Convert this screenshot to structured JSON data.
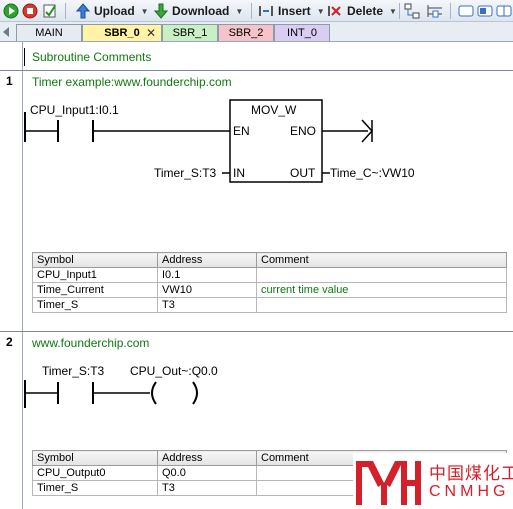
{
  "toolbar": {
    "upload_label": "Upload",
    "download_label": "Download",
    "insert_label": "Insert",
    "delete_label": "Delete"
  },
  "tabs": [
    {
      "label": "MAIN",
      "active": false,
      "color": "#e6ebf1"
    },
    {
      "label": "SBR_0",
      "active": true,
      "color": "#fff3a8"
    },
    {
      "label": "SBR_1",
      "active": false,
      "color": "#c9f0c4"
    },
    {
      "label": "SBR_2",
      "active": false,
      "color": "#f7c3c8"
    },
    {
      "label": "INT_0",
      "active": false,
      "color": "#d9cdf2"
    }
  ],
  "subroutine_comments": "Subroutine Comments",
  "networks": [
    {
      "number": "1",
      "title": "Timer example:www.founderchip.com",
      "contact_label": "CPU_Input1:I0.1",
      "block_name": "MOV_W",
      "pin_en": "EN",
      "pin_eno": "ENO",
      "pin_in": "IN",
      "pin_out": "OUT",
      "in_operand": "Timer_S:T3",
      "out_operand": "Time_C~:VW10",
      "symbol_table": {
        "headers": [
          "Symbol",
          "Address",
          "Comment"
        ],
        "rows": [
          [
            "CPU_Input1",
            "I0.1",
            ""
          ],
          [
            "Time_Current",
            "VW10",
            "current time value"
          ],
          [
            "Timer_S",
            "T3",
            ""
          ]
        ]
      }
    },
    {
      "number": "2",
      "title": "www.founderchip.com",
      "contact_label": "Timer_S:T3",
      "coil_label": "CPU_Out~:Q0.0",
      "symbol_table": {
        "headers": [
          "Symbol",
          "Address",
          "Comment"
        ],
        "rows": [
          [
            "CPU_Output0",
            "Q0.0",
            ""
          ],
          [
            "Timer_S",
            "T3",
            ""
          ]
        ]
      }
    }
  ],
  "watermark": {
    "text_cn": "中国煤化工",
    "text_en": "CNMHG",
    "color": "#d4202a"
  }
}
